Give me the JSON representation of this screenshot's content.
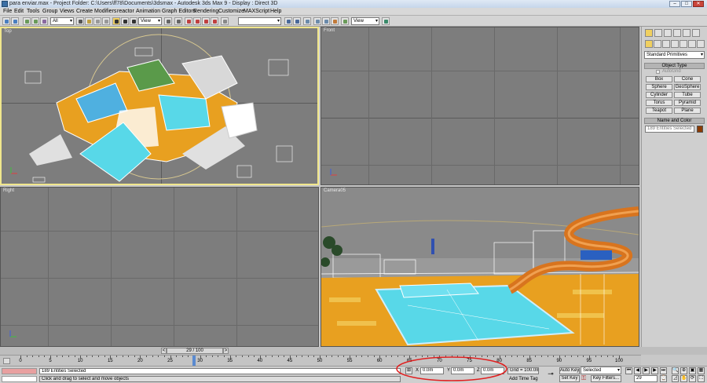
{
  "window": {
    "title": "para enviar.max    - Project Folder: C:\\Users\\ff78\\Documents\\3dsmax      - Autodesk 3ds Max 9      - Display : Direct 3D",
    "min_label": "–",
    "max_label": "□",
    "close_label": "✕"
  },
  "menu": [
    "File",
    "Edit",
    "Tools",
    "Group",
    "Views",
    "Create",
    "Modifiers",
    "reactor",
    "Animation",
    "Graph Editors",
    "Rendering",
    "Customize",
    "MAXScript",
    "Help"
  ],
  "toolbar": {
    "selection_filter": "All",
    "ref_coord": "View",
    "named_selection": "",
    "ref_coord2": "View"
  },
  "viewports": {
    "top": "Top",
    "front": "Front",
    "right": "Right",
    "camera": "Camera05"
  },
  "command_panel": {
    "category_dropdown": "Standard Primitives",
    "object_type_header": "Object Type",
    "autogrid_label": "AutoGrid",
    "primitives": [
      "Box",
      "Cone",
      "Sphere",
      "GeoSphere",
      "Cylinder",
      "Tube",
      "Torus",
      "Pyramid",
      "Teapot",
      "Plane"
    ],
    "name_color_header": "Name and Color",
    "name_field": "189 Entities Selected",
    "object_color": "#8b3a00"
  },
  "timeline": {
    "frame_indicator": "29 / 100",
    "current_frame_fraction": 0.29,
    "ticks": [
      "0",
      "5",
      "10",
      "15",
      "20",
      "25",
      "30",
      "35",
      "40",
      "45",
      "50",
      "55",
      "60",
      "65",
      "70",
      "75",
      "80",
      "85",
      "90",
      "95",
      "100"
    ]
  },
  "status": {
    "selection_text": "189 Entities Selected",
    "prompt_text": "Click and drag to select and move objects",
    "x_label": "X",
    "x_value": "0.0m",
    "y_label": "Y",
    "y_value": "0.0m",
    "z_label": "Z",
    "z_value": "0.0m",
    "grid_text": "Grid = 100.0m",
    "add_time_tag": "Add Time Tag",
    "auto_key_label": "Auto Key",
    "auto_key_dropdown": "Selected",
    "set_key_label": "Set Key",
    "key_filters_label": "Key Filters...",
    "frame_field": "29"
  },
  "colors": {
    "active_viewport_border": "#f0e68c",
    "viewport_bg": "#7d7d7d",
    "annotation_circle": "#e02020",
    "pool_water": "#58d8e8",
    "tile_orange": "#e8a020",
    "slide_orange": "#d8741e",
    "auto_key_red": "#e8a0a0"
  }
}
